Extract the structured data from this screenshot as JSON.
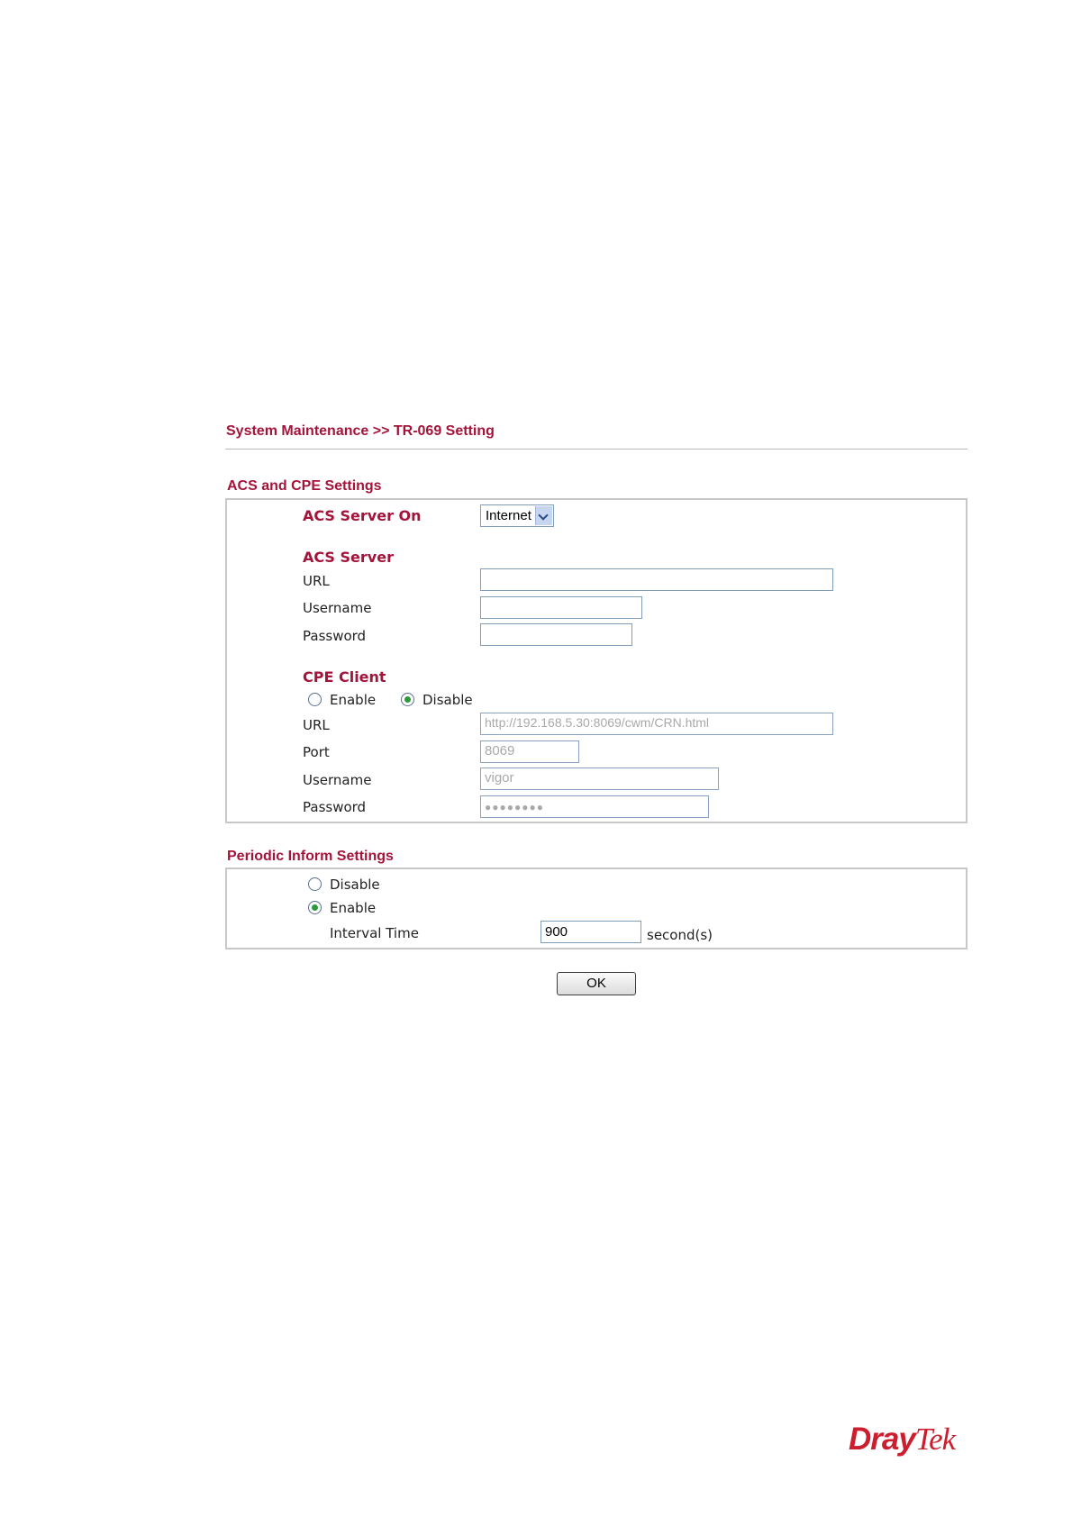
{
  "header": {
    "title": "System Maintenance >> TR-069 Setting"
  },
  "acs_cpe": {
    "heading": "ACS and CPE Settings",
    "acs_server_on_label": "ACS Server On",
    "acs_server_on_value": "Internet",
    "acs_server_heading": "ACS Server",
    "acs_url_label": "URL",
    "acs_url_value": "",
    "acs_username_label": "Username",
    "acs_username_value": "",
    "acs_password_label": "Password",
    "acs_password_value": "",
    "cpe_heading": "CPE Client",
    "cpe_enable_label": "Enable",
    "cpe_disable_label": "Disable",
    "cpe_selected": "Disable",
    "cpe_url_label": "URL",
    "cpe_url_value": "http://192.168.5.30:8069/cwm/CRN.html",
    "cpe_port_label": "Port",
    "cpe_port_value": "8069",
    "cpe_username_label": "Username",
    "cpe_username_value": "vigor",
    "cpe_password_label": "Password",
    "cpe_password_mask": "●●●●●●●●"
  },
  "periodic": {
    "heading": "Periodic Inform Settings",
    "disable_label": "Disable",
    "enable_label": "Enable",
    "selected": "Enable",
    "interval_label": "Interval Time",
    "interval_value": "900",
    "interval_unit": "second(s)"
  },
  "actions": {
    "ok_label": "OK"
  },
  "brand": {
    "logo_part1": "Dray",
    "logo_part2": "Tek",
    "color": "#cc1e2e"
  },
  "colors": {
    "accent": "#a4143a",
    "border": "#c8c8c8",
    "input_border": "#7f9db9"
  }
}
